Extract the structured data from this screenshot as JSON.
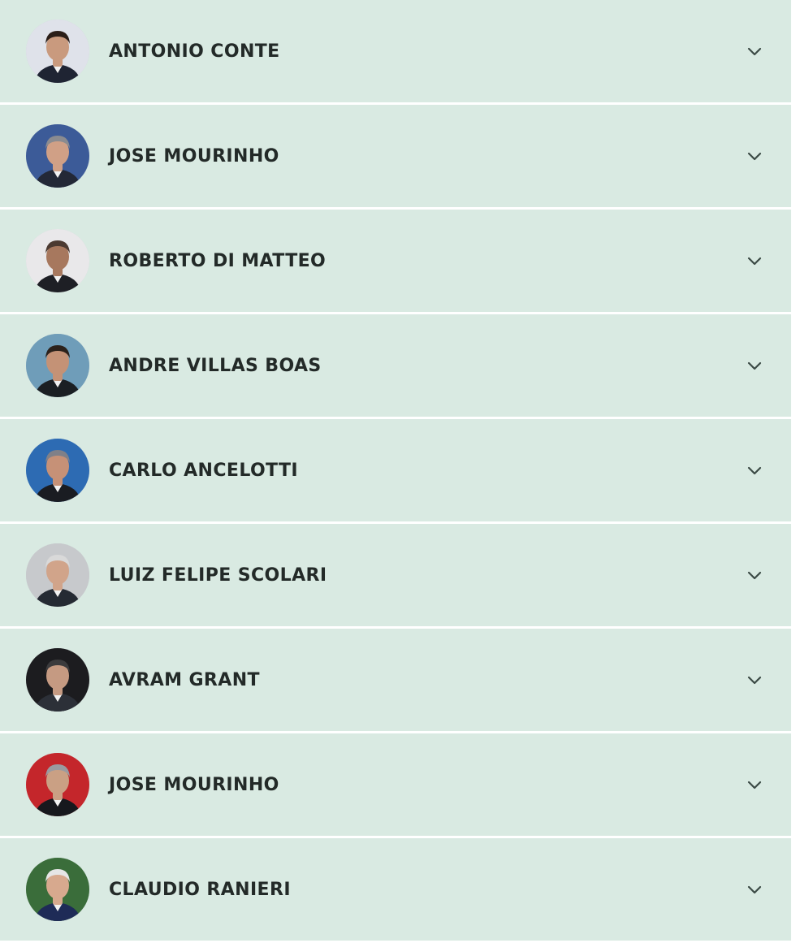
{
  "managers": [
    {
      "name": "ANTONIO CONTE",
      "avatar_bg": "#dfe2ea",
      "avatar_skin": "#c99a7e",
      "avatar_hair": "#2a1e18",
      "avatar_shirt": "#1f2433"
    },
    {
      "name": "JOSE MOURINHO",
      "avatar_bg": "#3c5b98",
      "avatar_skin": "#d0a086",
      "avatar_hair": "#8a8b90",
      "avatar_shirt": "#232836"
    },
    {
      "name": "ROBERTO DI MATTEO",
      "avatar_bg": "#e9e8ea",
      "avatar_skin": "#a7785e",
      "avatar_hair": "#4b3a31",
      "avatar_shirt": "#1e1f25"
    },
    {
      "name": "ANDRE VILLAS BOAS",
      "avatar_bg": "#6f9db9",
      "avatar_skin": "#c49276",
      "avatar_hair": "#2c221c",
      "avatar_shirt": "#1b1f23"
    },
    {
      "name": "CARLO ANCELOTTI",
      "avatar_bg": "#2d6bb3",
      "avatar_skin": "#c69177",
      "avatar_hair": "#808088",
      "avatar_shirt": "#1a1c22"
    },
    {
      "name": "LUIZ FELIPE SCOLARI",
      "avatar_bg": "#c7c9cc",
      "avatar_skin": "#d1a48a",
      "avatar_hair": "#d9d9d9",
      "avatar_shirt": "#252a33"
    },
    {
      "name": "AVRAM GRANT",
      "avatar_bg": "#1c1c1f",
      "avatar_skin": "#c59a82",
      "avatar_hair": "#3b3b3d",
      "avatar_shirt": "#2c3038"
    },
    {
      "name": "JOSE MOURINHO",
      "avatar_bg": "#c4262b",
      "avatar_skin": "#caa084",
      "avatar_hair": "#9a9aa0",
      "avatar_shirt": "#16181d"
    },
    {
      "name": "CLAUDIO RANIERI",
      "avatar_bg": "#3a6d3a",
      "avatar_skin": "#d7a98e",
      "avatar_hair": "#e6e6e6",
      "avatar_shirt": "#1e2b57"
    }
  ],
  "icons": {
    "expand": "chevron-down-icon"
  },
  "colors": {
    "row_bg": "#d9eae2",
    "name_text": "#232a28",
    "chevron": "#3b4a45"
  }
}
